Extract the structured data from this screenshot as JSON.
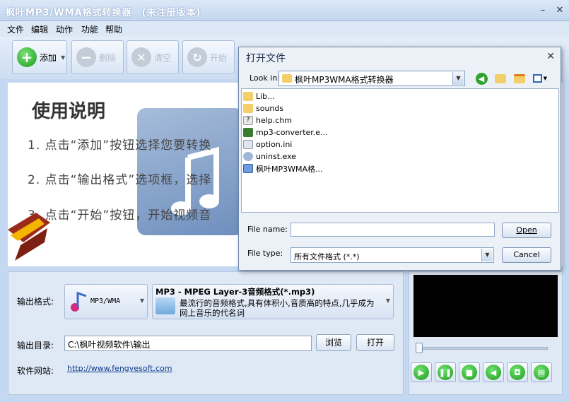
{
  "window": {
    "title": "枫叶MP3/WMA格式转换器",
    "subtitle": "(未注册版本)",
    "minimize": "–",
    "close": "✕"
  },
  "menu": [
    "文件",
    "编辑",
    "动作",
    "功能",
    "帮助"
  ],
  "toolbar": {
    "add": "添加",
    "delete": "删除",
    "clear": "清空",
    "start": "开始"
  },
  "guide": {
    "title": "使用说明",
    "steps": [
      "1. 点击“添加”按钮选择您要转换",
      "2. 点击“输出格式”选项框，选择",
      "3. 点击“开始”按钮，开始视频音"
    ]
  },
  "output": {
    "format_label": "输出格式:",
    "format_value": "MP3/WMA",
    "format_desc_title": "MP3 - MPEG Layer-3音频格式(*.mp3)",
    "format_desc_line1": "最流行的音频格式,具有体积小,音质高的特点,几乎成为",
    "format_desc_line2": "网上音乐的代名词",
    "dir_label": "输出目录:",
    "dir_value": "C:\\枫叶视频软件\\输出",
    "browse": "浏览",
    "open": "打开",
    "site_label": "软件网站:",
    "site_url": "http://www.fengyesoft.com"
  },
  "dialog": {
    "title": "打开文件",
    "look_in_label": "Look in:",
    "look_in_value": "枫叶MP3WMA格式转换器",
    "files": [
      {
        "name": "Lib...",
        "icon": "folder-icon"
      },
      {
        "name": "sounds",
        "icon": "folder-icon"
      },
      {
        "name": "help.chm",
        "icon": "help-file-icon"
      },
      {
        "name": "mp3-converter.e...",
        "icon": "exe-icon"
      },
      {
        "name": "option.ini",
        "icon": "ini-file-icon"
      },
      {
        "name": "uninst.exe",
        "icon": "uninstall-icon"
      },
      {
        "name": "枫叶MP3WMA格...",
        "icon": "shortcut-icon"
      }
    ],
    "file_name_label": "File name:",
    "file_name_value": "",
    "file_type_label": "File type:",
    "file_type_value": "所有文件格式 (*.*)",
    "open_btn": "Open",
    "cancel_btn": "Cancel"
  }
}
